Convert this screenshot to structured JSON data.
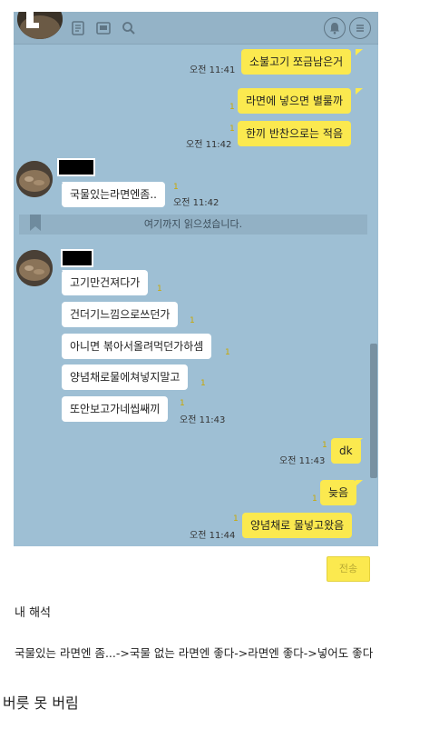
{
  "chat": {
    "topbar": {
      "icons": [
        "profile-avatar",
        "notes-icon",
        "box-icon",
        "search-icon",
        "bell-icon",
        "menu-icon"
      ]
    },
    "messages": [
      {
        "who": "me",
        "text": "소불고기 쪼금남은거",
        "time": "오전 11:41"
      },
      {
        "who": "me",
        "text": "라면에 넣으면 별룰까",
        "unread": "1"
      },
      {
        "who": "me",
        "text": "한끼 반찬으로는 적음",
        "unread": "1",
        "time": "오전 11:42"
      },
      {
        "who": "them",
        "text": "국물있는라면엔좀..",
        "unread": "1",
        "time": "오전 11:42"
      },
      {
        "who": "them",
        "text": "고기만건져다가",
        "unread": "1"
      },
      {
        "who": "them",
        "text": "건더기느낌으로쓰던가",
        "unread": "1"
      },
      {
        "who": "them",
        "text": "아니면 볶아서올려먹던가하셈",
        "unread": "1"
      },
      {
        "who": "them",
        "text": "양념채로물에쳐넣지말고",
        "unread": "1"
      },
      {
        "who": "them",
        "text": "또안보고가네씹쌔끼",
        "unread": "1",
        "time": "오전 11:43"
      },
      {
        "who": "me",
        "text": "dk",
        "unread": "1",
        "time": "오전 11:43"
      },
      {
        "who": "me",
        "text": "늦음",
        "unread": "1"
      },
      {
        "who": "me",
        "text": "양념채로 물넣고왔음",
        "unread": "1",
        "time": "오전 11:44"
      }
    ],
    "read_marker": "여기까지 읽으셨습니다.",
    "send_label": "전송"
  },
  "colors": {
    "chat_bg": "#9ebfd4",
    "my_bubble": "#fbe94f",
    "their_bubble": "#ffffff",
    "unread": "#c9a800"
  },
  "caption": {
    "title": "내 해석",
    "interpretation": "국물있는 라면엔 좀...->국물 없는 라면엔 좋다->라면엔 좋다->넣어도 좋다",
    "closing": "버릇 못 버림"
  }
}
